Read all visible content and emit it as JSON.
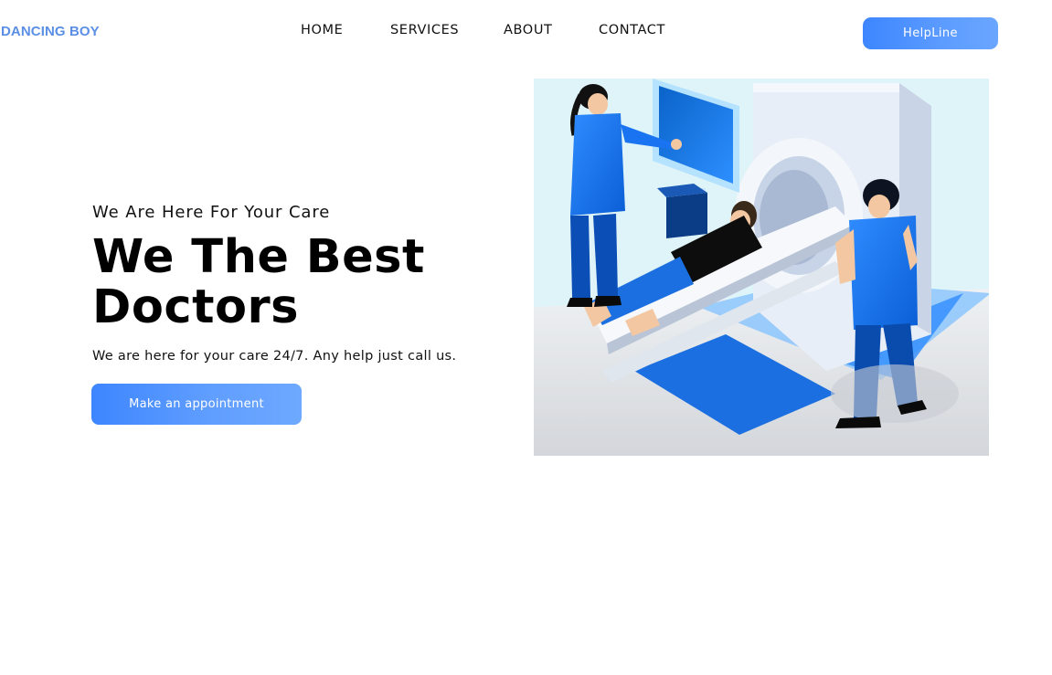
{
  "header": {
    "brand": "DANCING BOY",
    "nav": [
      {
        "label": "HOME"
      },
      {
        "label": "SERVICES"
      },
      {
        "label": "ABOUT"
      },
      {
        "label": "CONTACT"
      }
    ],
    "helpline_label": "HelpLine"
  },
  "hero": {
    "subtitle": "We Are Here For Your Care",
    "title": "We The Best Doctors",
    "description": "We are here for your care 24/7. Any help just call us.",
    "cta_label": "Make an appointment"
  },
  "colors": {
    "brand": "#5b8fe6",
    "accent": "#4a8fff",
    "text": "#000000",
    "background": "#ffffff"
  }
}
